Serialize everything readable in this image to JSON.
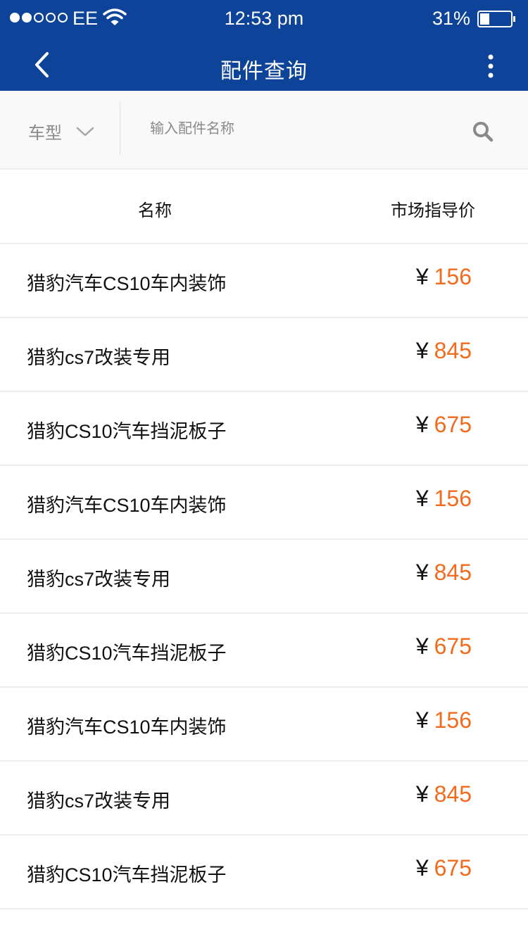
{
  "status_bar": {
    "carrier": "EE",
    "time": "12:53 pm",
    "battery": "31%",
    "battery_level": 0.31
  },
  "nav": {
    "title": "配件查询"
  },
  "search": {
    "model_label": "车型",
    "placeholder": "输入配件名称"
  },
  "table": {
    "headers": {
      "name": "名称",
      "price": "市场指导价"
    },
    "rows": [
      {
        "name": "猎豹汽车CS10车内装饰",
        "currency": "¥",
        "price": "156"
      },
      {
        "name": "猎豹cs7改装专用",
        "currency": "¥",
        "price": "845"
      },
      {
        "name": "猎豹CS10汽车挡泥板子",
        "currency": "¥",
        "price": "675"
      },
      {
        "name": "猎豹汽车CS10车内装饰",
        "currency": "¥",
        "price": "156"
      },
      {
        "name": "猎豹cs7改装专用",
        "currency": "¥",
        "price": "845"
      },
      {
        "name": "猎豹CS10汽车挡泥板子",
        "currency": "¥",
        "price": "675"
      },
      {
        "name": "猎豹汽车CS10车内装饰",
        "currency": "¥",
        "price": "156"
      },
      {
        "name": "猎豹cs7改装专用",
        "currency": "¥",
        "price": "845"
      },
      {
        "name": "猎豹CS10汽车挡泥板子",
        "currency": "¥",
        "price": "675"
      }
    ]
  },
  "colors": {
    "header_bg": "#0d4499",
    "price_accent": "#f26a1b"
  }
}
